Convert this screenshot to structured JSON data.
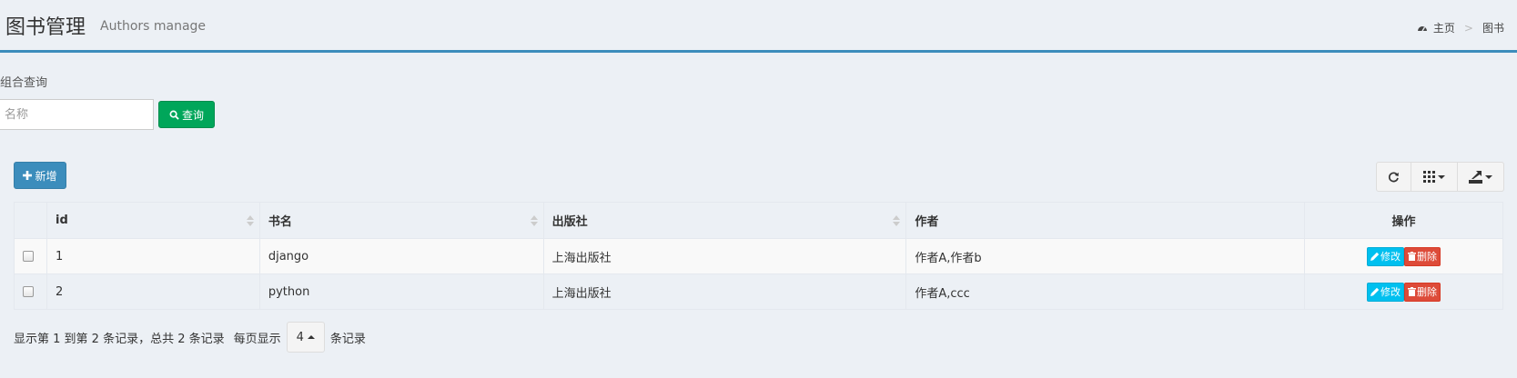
{
  "header": {
    "title": "图书管理",
    "subtitle": "Authors manage",
    "breadcrumb": {
      "home": "主页",
      "separator": ">",
      "current": "图书"
    }
  },
  "search": {
    "title": "组合查询",
    "placeholder": "名称",
    "button_label": "查询"
  },
  "toolbar": {
    "add_label": "新增"
  },
  "table": {
    "columns": [
      "id",
      "书名",
      "出版社",
      "作者",
      "操作"
    ],
    "rows": [
      {
        "id": "1",
        "name": "django",
        "publisher": "上海出版社",
        "authors": "作者A,作者b"
      },
      {
        "id": "2",
        "name": "python",
        "publisher": "上海出版社",
        "authors": "作者A,ccc"
      }
    ],
    "edit_label": "修改",
    "delete_label": "删除"
  },
  "pagination": {
    "summary": "显示第 1 到第 2 条记录，总共 2 条记录",
    "per_page_prefix": "每页显示",
    "page_size": "4",
    "per_page_suffix": "条记录"
  },
  "colors": {
    "accent": "#3c8dbc",
    "success": "#00a65a",
    "info": "#00c0ef",
    "danger": "#dd4b39",
    "background": "#ecf0f5"
  },
  "icons": {
    "breadcrumb": "dashboard-icon",
    "query": "search-icon",
    "add": "plus-icon",
    "refresh": "refresh-icon",
    "columns": "grid-icon",
    "export": "export-icon",
    "edit": "pencil-icon",
    "delete": "trash-icon"
  }
}
